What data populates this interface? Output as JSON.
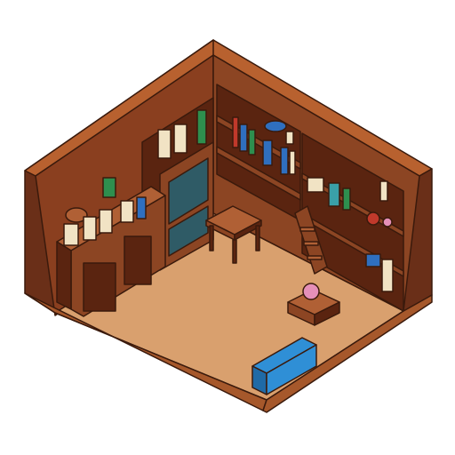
{
  "scene": {
    "kind": "isometric-room",
    "description_free": true
  },
  "palette": {
    "outline": "#3a1a0c",
    "wall_top": "#b8612f",
    "wall_left": "#6a2f18",
    "wall_right": "#6a2f18",
    "wall_inner": "#8a3f1f",
    "wood_mid": "#8c4523",
    "wood_light": "#b06035",
    "wood_dark": "#5a2410",
    "floor": "#d9a06e",
    "floor_edge": "#a6582b",
    "book_blue": "#2f6fbf",
    "book_green": "#2e8f4e",
    "book_red": "#c0392b",
    "book_cream": "#f1e3c4",
    "glass_teal": "#3aa0a8",
    "toy_blue": "#2f8fd6",
    "potion_pink": "#e58fb8"
  },
  "objects": [
    {
      "name": "back-left-counter",
      "interactable": true
    },
    {
      "name": "left-bookshelf",
      "interactable": true
    },
    {
      "name": "glass-cabinet",
      "interactable": true
    },
    {
      "name": "back-bookshelf",
      "interactable": true
    },
    {
      "name": "wooden-table",
      "interactable": true
    },
    {
      "name": "wooden-ladder",
      "interactable": true
    },
    {
      "name": "right-bookshelf",
      "interactable": true
    },
    {
      "name": "potion-stand",
      "interactable": true
    },
    {
      "name": "blue-toy-crate",
      "interactable": true
    }
  ]
}
